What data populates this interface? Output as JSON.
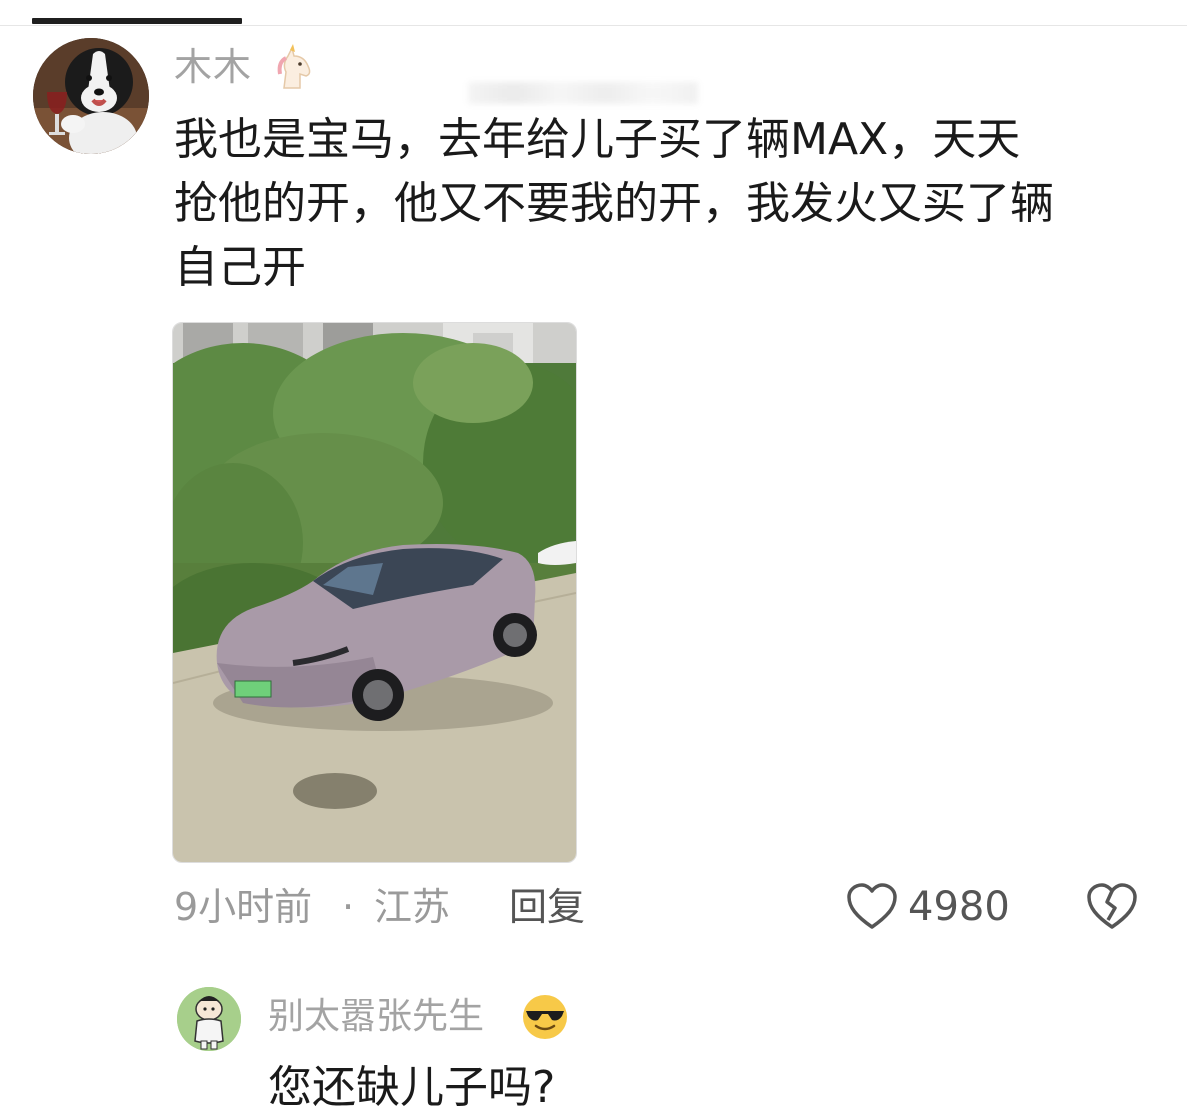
{
  "comment": {
    "username": "木木",
    "badge_icon": "unicorn-icon",
    "text": "我也是宝马，去年给儿子买了辆MAX，天天\n抢他的开，他又不要我的开，我发火又买了辆\n自己开",
    "time": "9小时前",
    "separator": "·",
    "location": "江苏",
    "reply_label": "回复",
    "likes": "4980",
    "like_icon": "heart-outline-icon",
    "dislike_icon": "broken-heart-icon"
  },
  "reply": {
    "username": "别太嚣张先生",
    "badge_icon": "sunglasses-emoji-icon",
    "text": "您还缺儿子吗?"
  },
  "colors": {
    "text_primary": "#1a1a1a",
    "text_secondary": "#9a9a9a",
    "divider": "#e6e6e6",
    "car_body": "#a89aa8",
    "plate_green": "#6fcf7a"
  }
}
